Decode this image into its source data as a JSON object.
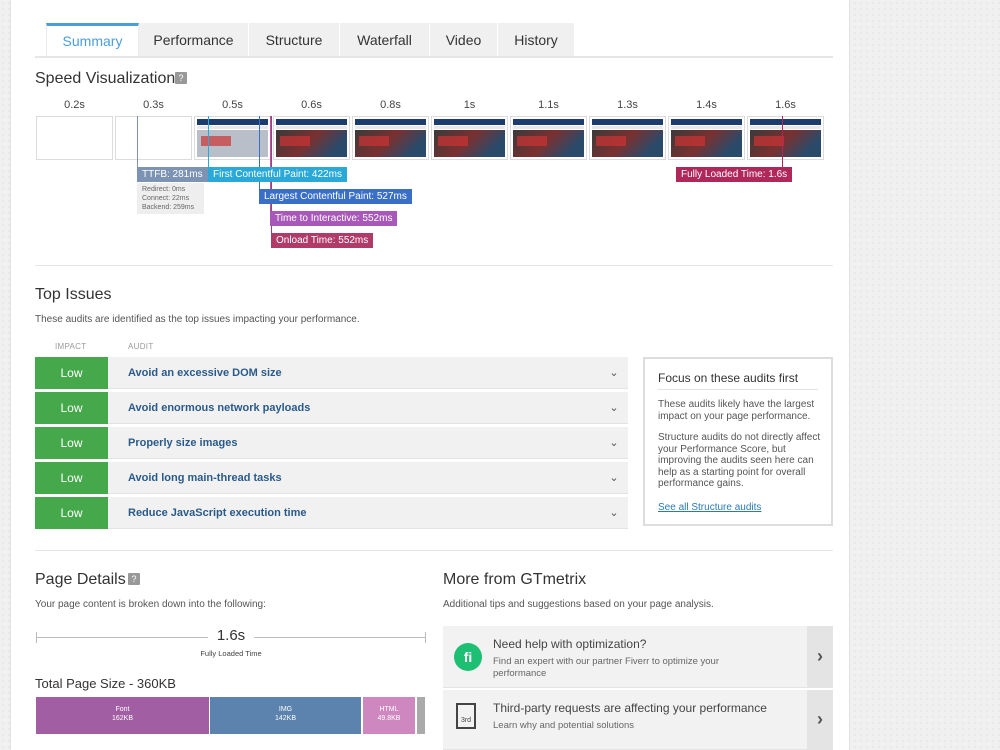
{
  "tabs": [
    "Summary",
    "Performance",
    "Structure",
    "Waterfall",
    "Video",
    "History"
  ],
  "speed": {
    "title": "Speed Visualization",
    "help": "?",
    "times": [
      "0.2s",
      "0.3s",
      "0.5s",
      "0.6s",
      "0.8s",
      "1s",
      "1.1s",
      "1.3s",
      "1.4s",
      "1.6s"
    ],
    "ttfb": "TTFB: 281ms",
    "ttfb_details": [
      "Redirect: 0ms",
      "Connect: 22ms",
      "Backend: 259ms"
    ],
    "fcp": "First Contentful Paint: 422ms",
    "lcp": "Largest Contentful Paint: 527ms",
    "tti": "Time to Interactive: 552ms",
    "onload": "Onload Time: 552ms",
    "fully": "Fully Loaded Time: 1.6s",
    "colors": {
      "ttfb": "#7d93b4",
      "fcp": "#2aa9d8",
      "lcp": "#3a6fc8",
      "tti": "#a858b8",
      "onload": "#b03a68",
      "fully": "#b0285a"
    }
  },
  "issues": {
    "title": "Top Issues",
    "description": "These audits are identified as the top issues impacting your performance.",
    "impact_header": "IMPACT",
    "audit_header": "AUDIT",
    "rows": [
      {
        "impact": "Low",
        "audit": "Avoid an excessive DOM size"
      },
      {
        "impact": "Low",
        "audit": "Avoid enormous network payloads"
      },
      {
        "impact": "Low",
        "audit": "Properly size images"
      },
      {
        "impact": "Low",
        "audit": "Avoid long main-thread tasks"
      },
      {
        "impact": "Low",
        "audit": "Reduce JavaScript execution time"
      }
    ],
    "focus": {
      "title": "Focus on these audits first",
      "p1": "These audits likely have the largest impact on your page performance.",
      "p2": "Structure audits do not directly affect your Performance Score, but improving the audits seen here can help as a starting point for overall performance gains.",
      "link": "See all Structure audits"
    }
  },
  "page_details": {
    "title": "Page Details",
    "help": "?",
    "description": "Your page content is broken down into the following:",
    "fully_value": "1.6s",
    "fully_label": "Fully Loaded Time",
    "size_title": "Total Page Size - 360KB",
    "segments": [
      {
        "name": "Font",
        "size": "162KB",
        "color": "#a15ea3"
      },
      {
        "name": "IMG",
        "size": "142KB",
        "color": "#5b83ae"
      },
      {
        "name": "HTML",
        "size": "49.8KB",
        "color": "#cf87c0"
      }
    ],
    "segment_fraction": [
      0.45,
      0.394,
      0.138,
      0.018
    ]
  },
  "more": {
    "title": "More from GTmetrix",
    "description": "Additional tips and suggestions based on your page analysis.",
    "items": [
      {
        "title": "Need help with optimization?",
        "sub": "Find an expert with our partner Fiverr to optimize your performance",
        "icon": "fi"
      },
      {
        "title": "Third-party requests are affecting your performance",
        "sub": "Learn why and potential solutions",
        "icon": "3rd"
      }
    ]
  }
}
